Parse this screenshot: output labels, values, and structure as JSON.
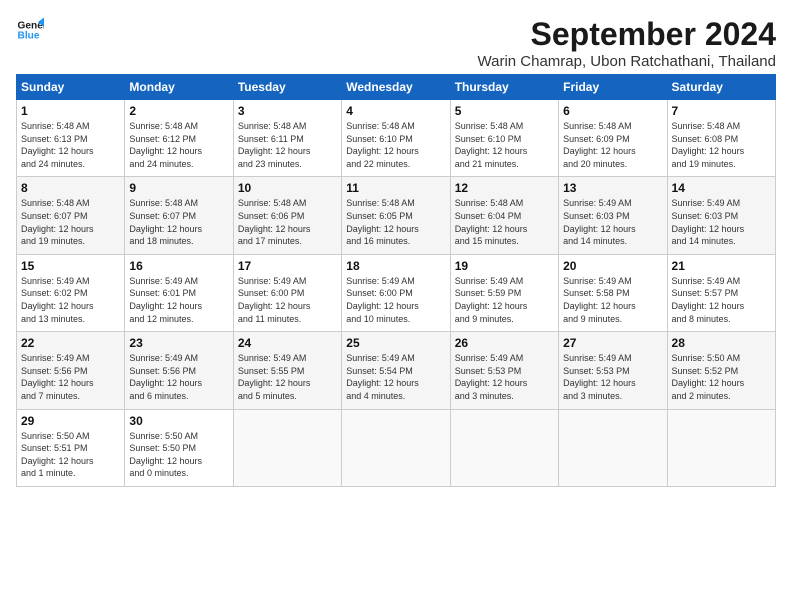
{
  "header": {
    "logo_line1": "General",
    "logo_line2": "Blue",
    "month": "September 2024",
    "location": "Warin Chamrap, Ubon Ratchathani, Thailand"
  },
  "weekdays": [
    "Sunday",
    "Monday",
    "Tuesday",
    "Wednesday",
    "Thursday",
    "Friday",
    "Saturday"
  ],
  "weeks": [
    [
      {
        "day": "1",
        "info": "Sunrise: 5:48 AM\nSunset: 6:13 PM\nDaylight: 12 hours\nand 24 minutes."
      },
      {
        "day": "2",
        "info": "Sunrise: 5:48 AM\nSunset: 6:12 PM\nDaylight: 12 hours\nand 24 minutes."
      },
      {
        "day": "3",
        "info": "Sunrise: 5:48 AM\nSunset: 6:11 PM\nDaylight: 12 hours\nand 23 minutes."
      },
      {
        "day": "4",
        "info": "Sunrise: 5:48 AM\nSunset: 6:10 PM\nDaylight: 12 hours\nand 22 minutes."
      },
      {
        "day": "5",
        "info": "Sunrise: 5:48 AM\nSunset: 6:10 PM\nDaylight: 12 hours\nand 21 minutes."
      },
      {
        "day": "6",
        "info": "Sunrise: 5:48 AM\nSunset: 6:09 PM\nDaylight: 12 hours\nand 20 minutes."
      },
      {
        "day": "7",
        "info": "Sunrise: 5:48 AM\nSunset: 6:08 PM\nDaylight: 12 hours\nand 19 minutes."
      }
    ],
    [
      {
        "day": "8",
        "info": "Sunrise: 5:48 AM\nSunset: 6:07 PM\nDaylight: 12 hours\nand 19 minutes."
      },
      {
        "day": "9",
        "info": "Sunrise: 5:48 AM\nSunset: 6:07 PM\nDaylight: 12 hours\nand 18 minutes."
      },
      {
        "day": "10",
        "info": "Sunrise: 5:48 AM\nSunset: 6:06 PM\nDaylight: 12 hours\nand 17 minutes."
      },
      {
        "day": "11",
        "info": "Sunrise: 5:48 AM\nSunset: 6:05 PM\nDaylight: 12 hours\nand 16 minutes."
      },
      {
        "day": "12",
        "info": "Sunrise: 5:48 AM\nSunset: 6:04 PM\nDaylight: 12 hours\nand 15 minutes."
      },
      {
        "day": "13",
        "info": "Sunrise: 5:49 AM\nSunset: 6:03 PM\nDaylight: 12 hours\nand 14 minutes."
      },
      {
        "day": "14",
        "info": "Sunrise: 5:49 AM\nSunset: 6:03 PM\nDaylight: 12 hours\nand 14 minutes."
      }
    ],
    [
      {
        "day": "15",
        "info": "Sunrise: 5:49 AM\nSunset: 6:02 PM\nDaylight: 12 hours\nand 13 minutes."
      },
      {
        "day": "16",
        "info": "Sunrise: 5:49 AM\nSunset: 6:01 PM\nDaylight: 12 hours\nand 12 minutes."
      },
      {
        "day": "17",
        "info": "Sunrise: 5:49 AM\nSunset: 6:00 PM\nDaylight: 12 hours\nand 11 minutes."
      },
      {
        "day": "18",
        "info": "Sunrise: 5:49 AM\nSunset: 6:00 PM\nDaylight: 12 hours\nand 10 minutes."
      },
      {
        "day": "19",
        "info": "Sunrise: 5:49 AM\nSunset: 5:59 PM\nDaylight: 12 hours\nand 9 minutes."
      },
      {
        "day": "20",
        "info": "Sunrise: 5:49 AM\nSunset: 5:58 PM\nDaylight: 12 hours\nand 9 minutes."
      },
      {
        "day": "21",
        "info": "Sunrise: 5:49 AM\nSunset: 5:57 PM\nDaylight: 12 hours\nand 8 minutes."
      }
    ],
    [
      {
        "day": "22",
        "info": "Sunrise: 5:49 AM\nSunset: 5:56 PM\nDaylight: 12 hours\nand 7 minutes."
      },
      {
        "day": "23",
        "info": "Sunrise: 5:49 AM\nSunset: 5:56 PM\nDaylight: 12 hours\nand 6 minutes."
      },
      {
        "day": "24",
        "info": "Sunrise: 5:49 AM\nSunset: 5:55 PM\nDaylight: 12 hours\nand 5 minutes."
      },
      {
        "day": "25",
        "info": "Sunrise: 5:49 AM\nSunset: 5:54 PM\nDaylight: 12 hours\nand 4 minutes."
      },
      {
        "day": "26",
        "info": "Sunrise: 5:49 AM\nSunset: 5:53 PM\nDaylight: 12 hours\nand 3 minutes."
      },
      {
        "day": "27",
        "info": "Sunrise: 5:49 AM\nSunset: 5:53 PM\nDaylight: 12 hours\nand 3 minutes."
      },
      {
        "day": "28",
        "info": "Sunrise: 5:50 AM\nSunset: 5:52 PM\nDaylight: 12 hours\nand 2 minutes."
      }
    ],
    [
      {
        "day": "29",
        "info": "Sunrise: 5:50 AM\nSunset: 5:51 PM\nDaylight: 12 hours\nand 1 minute."
      },
      {
        "day": "30",
        "info": "Sunrise: 5:50 AM\nSunset: 5:50 PM\nDaylight: 12 hours\nand 0 minutes."
      },
      {
        "day": "",
        "info": ""
      },
      {
        "day": "",
        "info": ""
      },
      {
        "day": "",
        "info": ""
      },
      {
        "day": "",
        "info": ""
      },
      {
        "day": "",
        "info": ""
      }
    ]
  ]
}
